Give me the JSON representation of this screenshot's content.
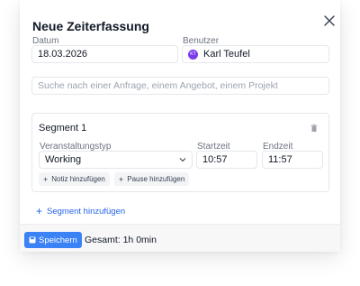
{
  "dialog": {
    "title": "Neue Zeiterfassung",
    "close_icon": "close-icon"
  },
  "date": {
    "label": "Datum",
    "value": "18.03.2026"
  },
  "user": {
    "label": "Benutzer",
    "value": "Karl Teufel",
    "initials": "KT",
    "avatar_color": "#7c3aed"
  },
  "search": {
    "placeholder": "Suche nach einer Anfrage, einem Angebot, einem Projekt"
  },
  "segment": {
    "title": "Segment 1",
    "event_type": {
      "label": "Veranstaltungstyp",
      "value": "Working"
    },
    "start": {
      "label": "Startzeit",
      "value": "10:57"
    },
    "end": {
      "label": "Endzeit",
      "value": "11:57"
    },
    "add_note": "Notiz hinzufügen",
    "add_pause": "Pause hinzufügen"
  },
  "add_segment": "Segment hinzufügen",
  "footer": {
    "save_label": "Speichern",
    "total": "Gesamt: 1h 0min"
  },
  "colors": {
    "accent": "#3b82f6",
    "link": "#2563eb"
  }
}
